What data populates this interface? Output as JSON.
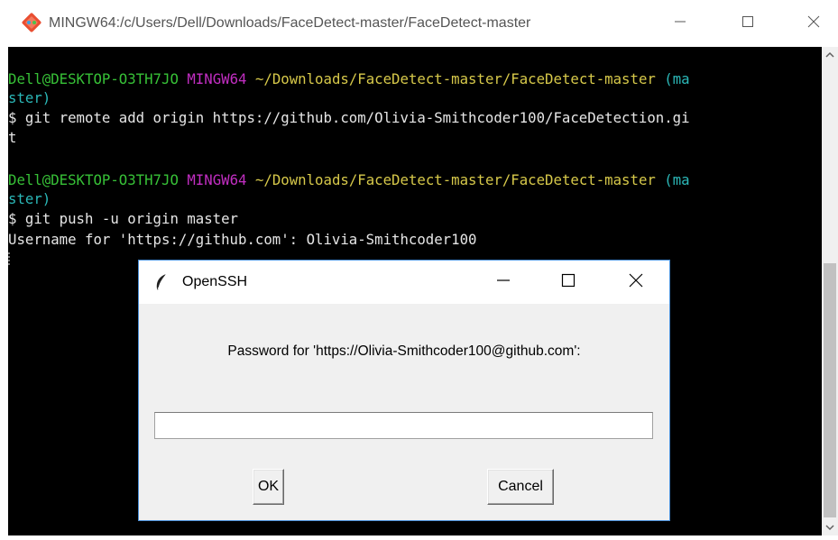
{
  "window": {
    "title": "MINGW64:/c/Users/Dell/Downloads/FaceDetect-master/FaceDetect-master",
    "icon": "git-bash-icon",
    "controls": [
      "minimize-icon",
      "maximize-icon",
      "close-icon"
    ]
  },
  "terminal": {
    "prompt1": {
      "user": "Dell@DESKTOP-O3TH7JO",
      "env": "MINGW64",
      "path": "~/Downloads/FaceDetect-master/FaceDetect-master",
      "branch_start": "(ma",
      "branch_end": "ster)"
    },
    "command1_line1": "$ git remote add origin https://github.com/Olivia-Smithcoder100/FaceDetection.gi",
    "command1_line2": "t",
    "prompt2": {
      "user": "Dell@DESKTOP-O3TH7JO",
      "env": "MINGW64",
      "path": "~/Downloads/FaceDetect-master/FaceDetect-master",
      "branch_start": "(ma",
      "branch_end": "ster)"
    },
    "command2": "$ git push -u origin master",
    "output1": "Username for 'https://github.com': Olivia-Smithcoder100"
  },
  "dialog": {
    "title": "OpenSSH",
    "icon": "feather-icon",
    "prompt": "Password for 'https://Olivia-Smithcoder100@github.com':",
    "input_value": "",
    "ok_label": "OK",
    "cancel_label": "Cancel"
  },
  "colors": {
    "terminal_bg": "#000000",
    "user_green": "#37c137",
    "env_magenta": "#c22ec2",
    "path_yellow": "#d7c94a",
    "branch_cyan": "#2bb8b8",
    "dialog_border": "#4a90d9"
  }
}
